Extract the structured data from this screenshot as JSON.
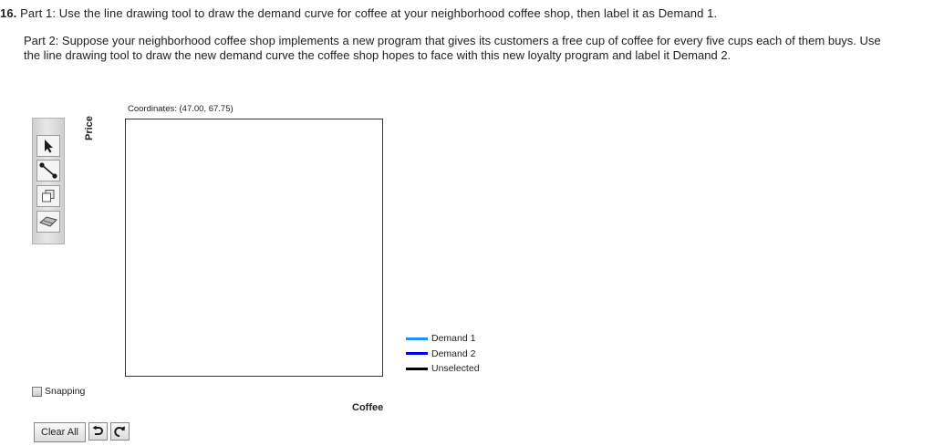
{
  "question": {
    "number": "16.",
    "part1": "Part 1: Use the line drawing tool to draw the demand curve for coffee at your neighborhood coffee shop, then label it as Demand 1.",
    "part2": "Part 2: Suppose your neighborhood coffee shop implements a new program that gives its customers a free cup of coffee for every five cups each of them buys. Use the line drawing tool to draw the new demand curve the coffee shop hopes to face with this new loyalty program and label it Demand 2."
  },
  "graph": {
    "coordinates_text": "Coordinates: (47.00, 67.75)",
    "y_axis_label": "Price",
    "x_axis_label": "Coffee"
  },
  "toolbar": {
    "tools": [
      "pointer-icon",
      "line-tool-icon",
      "duplicate-icon",
      "eraser-icon"
    ]
  },
  "legend": [
    {
      "label": "Demand 1",
      "color": "#1e90ff"
    },
    {
      "label": "Demand 2",
      "color": "#0000e0"
    },
    {
      "label": "Unselected",
      "color": "#000000"
    }
  ],
  "controls": {
    "snapping_label": "Snapping",
    "snapping_checked": false,
    "clear_all_label": "Clear All",
    "undo_icon": "undo-icon",
    "redo_icon": "redo-icon"
  }
}
